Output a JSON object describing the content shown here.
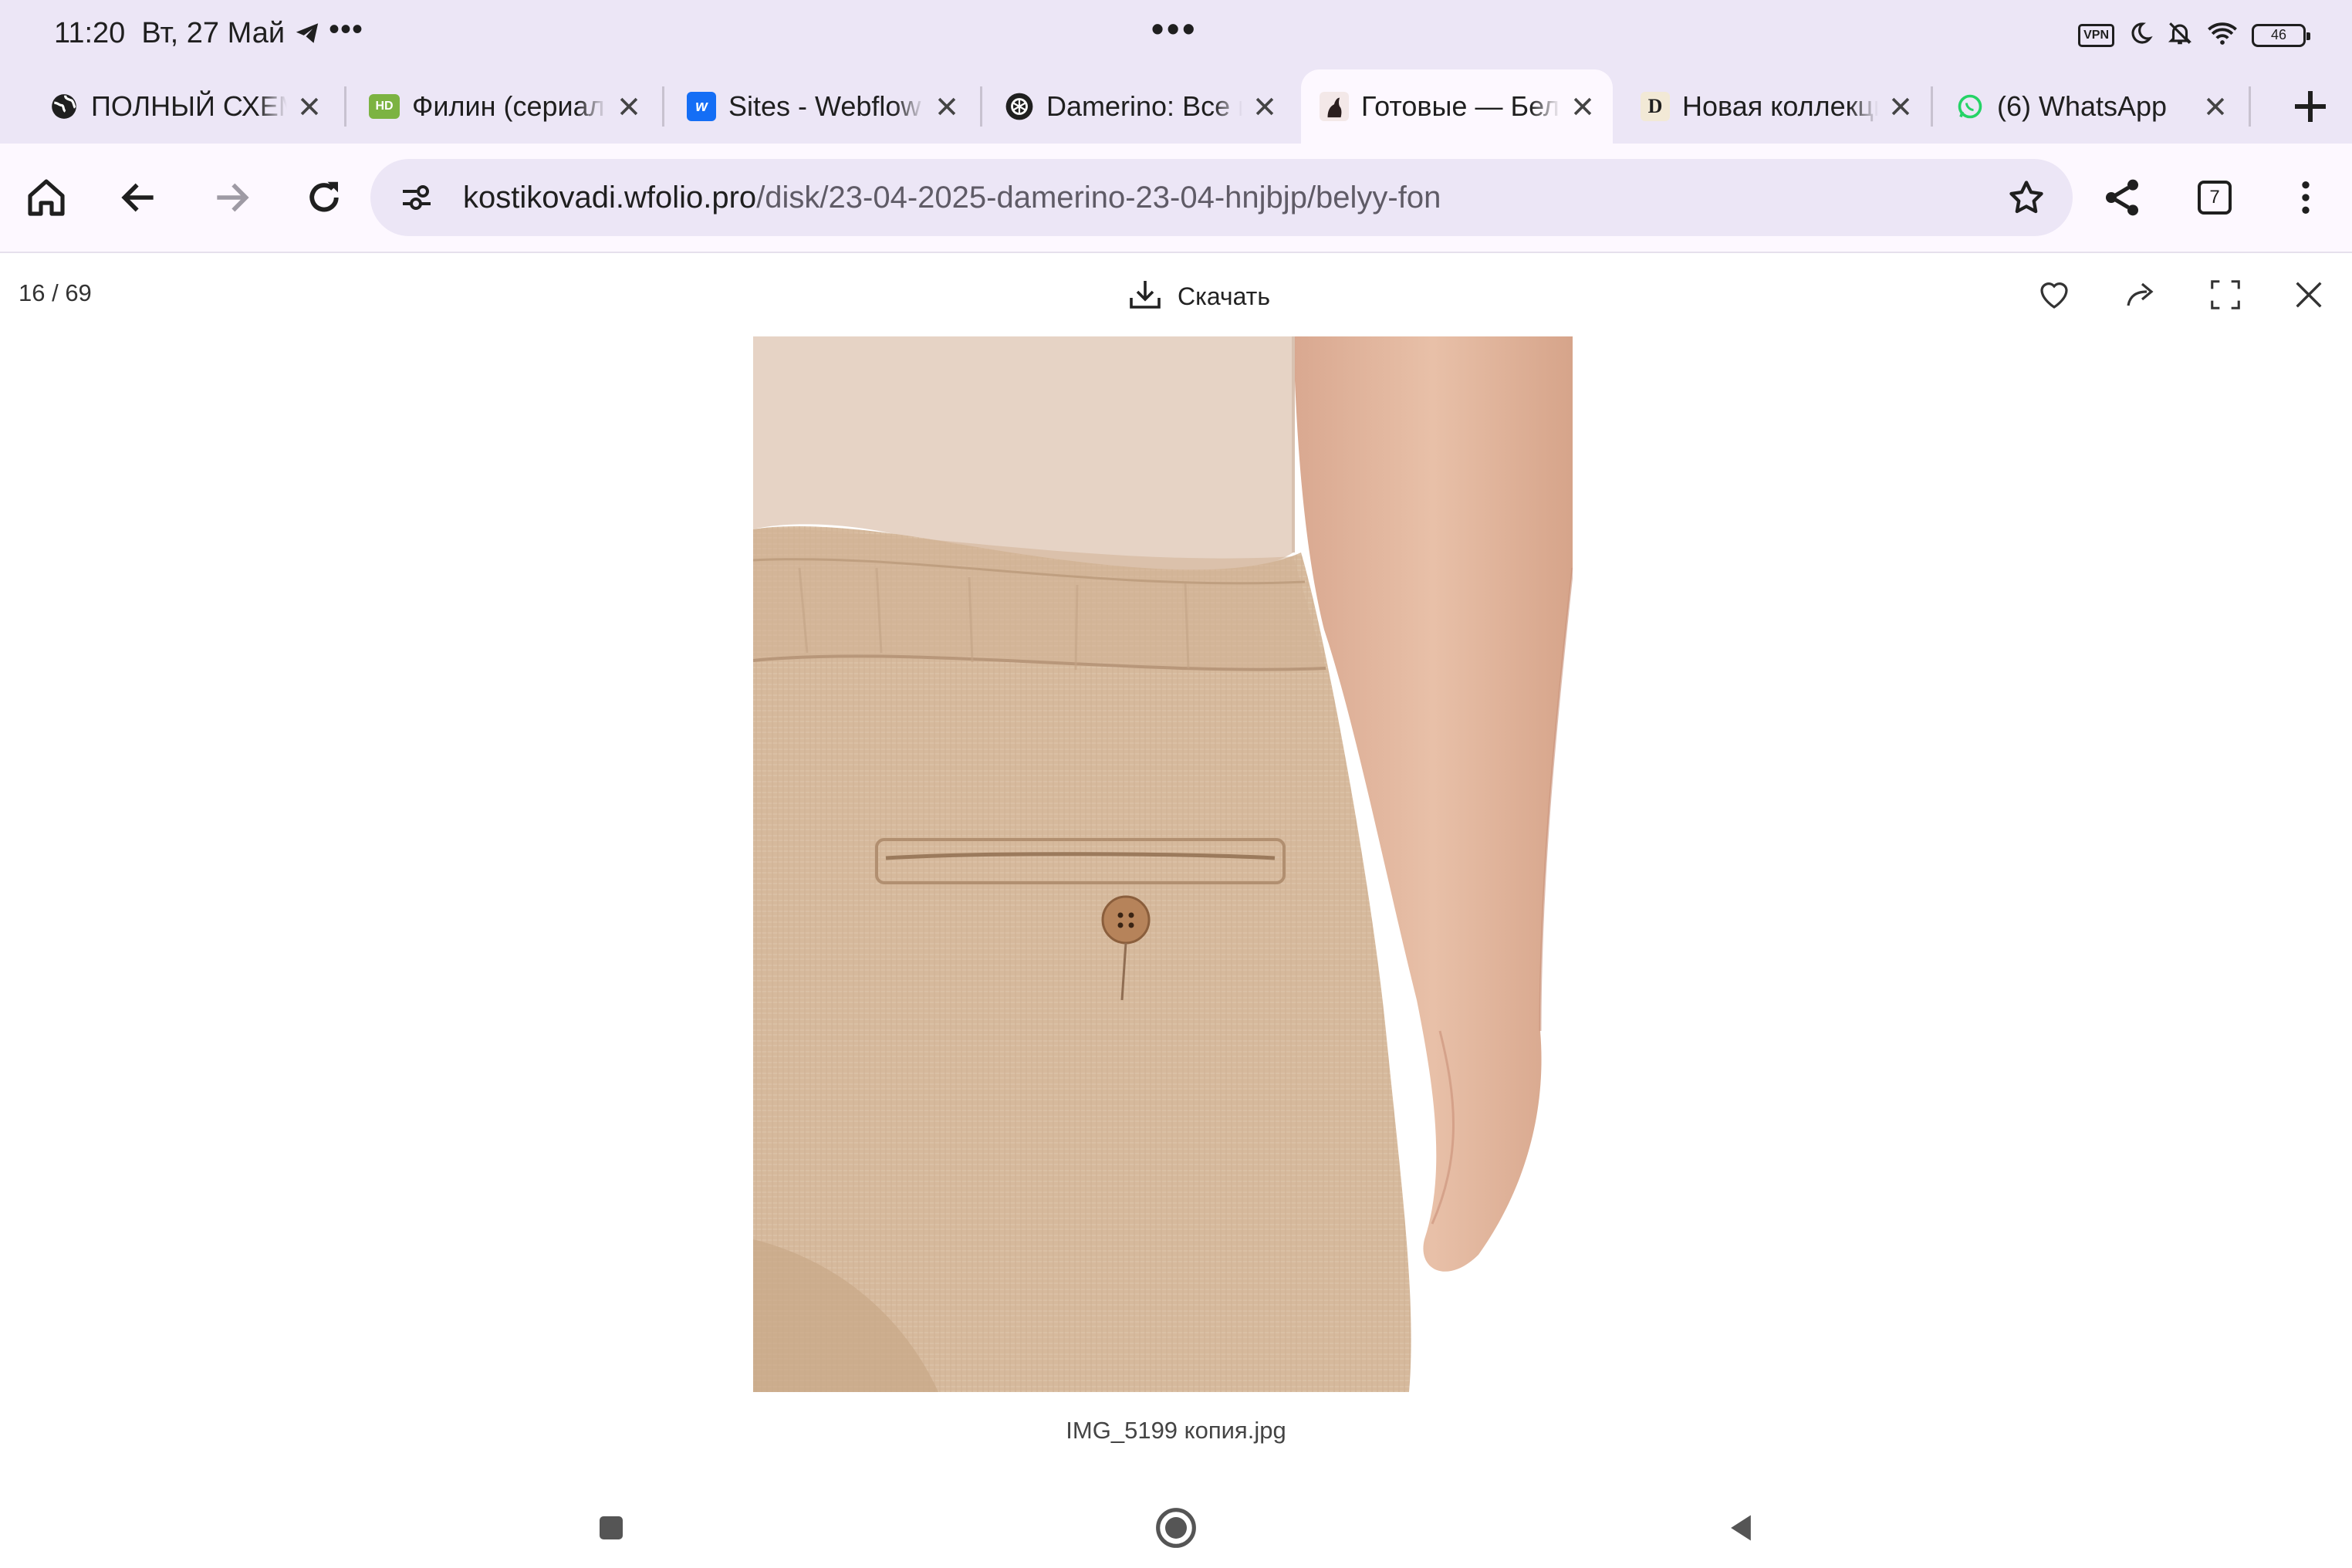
{
  "status_bar": {
    "time": "11:20",
    "date": "Вт, 27 Май",
    "more": "•••",
    "center_handle": "•••",
    "vpn": "VPN",
    "battery": "46",
    "icons": [
      "telegram-icon",
      "vpn-icon",
      "moon-icon",
      "bell-off-icon",
      "wifi-icon",
      "battery-icon"
    ]
  },
  "tabs": [
    {
      "title": "ПОЛНЫЙ СХЕМ",
      "icon": "globe-icon",
      "icon_color": "#1f1f1f",
      "active": false
    },
    {
      "title": "Филин (сериал,",
      "icon": "hd-icon",
      "icon_color": "#7cb342",
      "active": false
    },
    {
      "title": "Sites - Webflow",
      "icon": "webflow-icon",
      "icon_color": "#146ef5",
      "active": false
    },
    {
      "title": "Damerino: Все и",
      "icon": "openai-icon",
      "icon_color": "#1f1f1f",
      "active": false
    },
    {
      "title": "Готовые — Бел",
      "icon": "photo-favicon",
      "icon_color": "#3a2a2a",
      "active": true
    },
    {
      "title": "Новая коллекци",
      "icon": "d-logo-icon",
      "icon_color": "#f2e9d6",
      "active": false
    },
    {
      "title": "(6) WhatsApp",
      "icon": "whatsapp-icon",
      "icon_color": "#25d366",
      "active": false
    }
  ],
  "toolbar": {
    "url_host": "kostikovadi.wfolio.pro",
    "url_path": "/disk/23-04-2025-damerino-23-04-hnjbjp/belyy-fon",
    "tab_count": "7"
  },
  "viewer": {
    "counter": "16 / 69",
    "download_label": "Скачать",
    "caption": "IMG_5199 копия.jpg"
  },
  "colors": {
    "chrome_bg": "#ece6f6",
    "active_tab_bg": "#fdf8ff",
    "fabric": "#d8bca0",
    "shirt": "#e8d6c8",
    "skin": "#e0b59a"
  }
}
